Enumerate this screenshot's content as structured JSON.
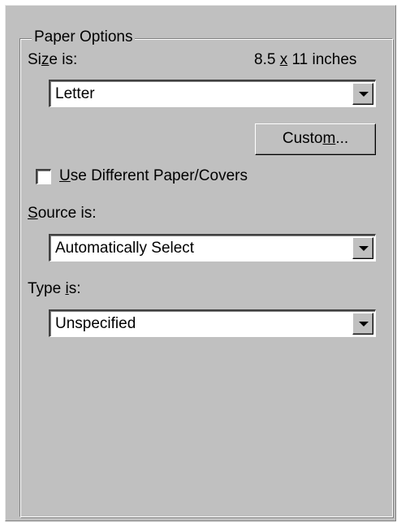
{
  "paper_options": {
    "group_title": "Paper Options",
    "size": {
      "label_pre": "Si",
      "label_key": "z",
      "label_post": "e is:",
      "dimension_pre": "8.5 ",
      "dimension_key": "x",
      "dimension_post": " 11 inches",
      "selected": "Letter"
    },
    "custom_button": {
      "label_pre": "Custo",
      "label_key": "m",
      "label_post": "..."
    },
    "different_paper": {
      "label_key": "U",
      "label_post": "se Different Paper/Covers",
      "checked": false
    },
    "source": {
      "label_key": "S",
      "label_post": "ource is:",
      "selected": "Automatically Select"
    },
    "type": {
      "label_pre": "Type ",
      "label_key": "i",
      "label_post": "s:",
      "selected": "Unspecified"
    }
  },
  "icons": {
    "dropdown": "chevron-down-icon",
    "checkbox": "checkbox-unchecked-icon"
  },
  "colors": {
    "face": "#c0c0c0",
    "shadow": "#808080",
    "highlight": "#ffffff",
    "field": "#ffffff"
  }
}
